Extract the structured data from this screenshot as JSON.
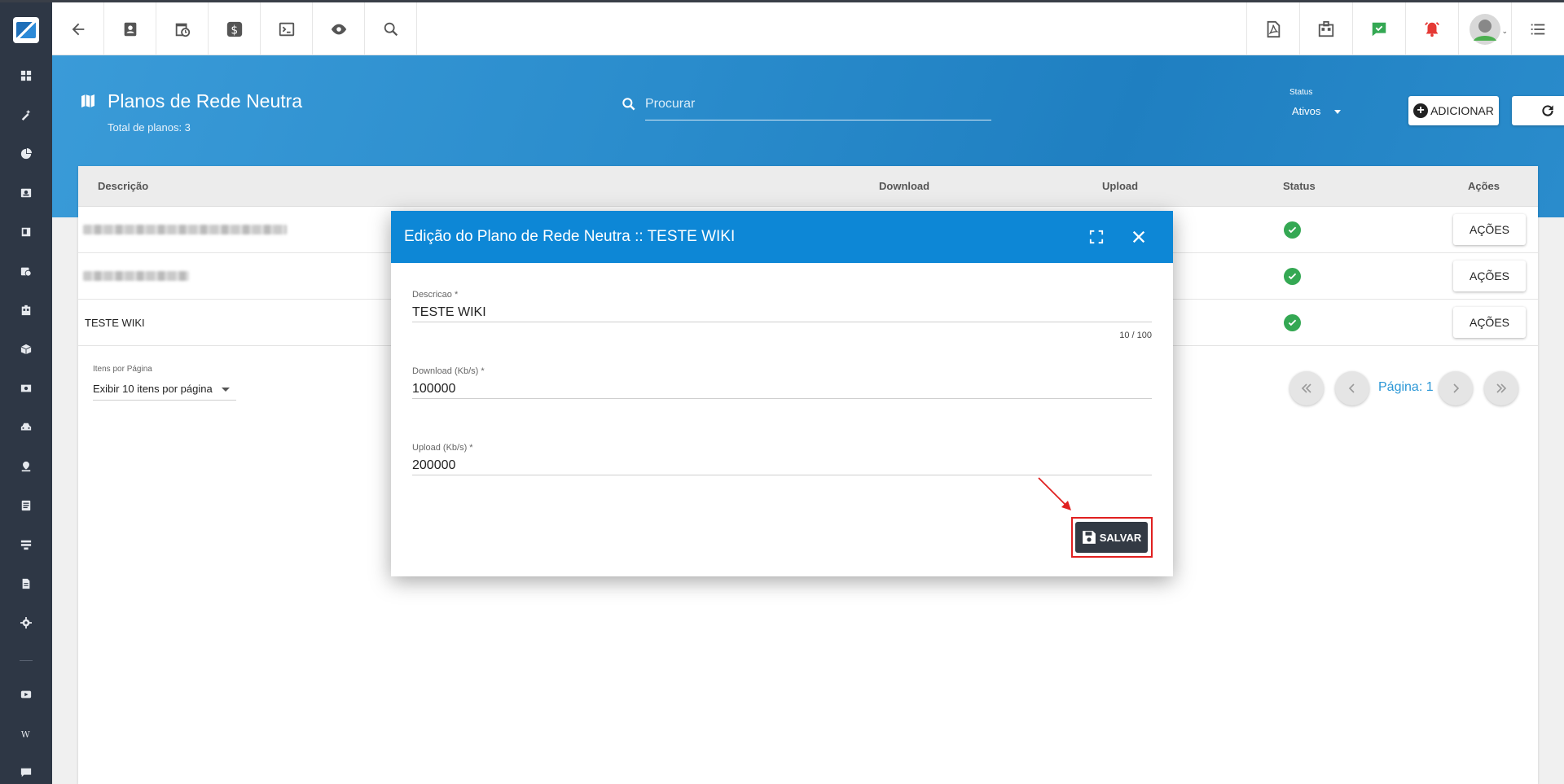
{
  "topbar": {
    "left_icons": [
      "back-arrow-icon",
      "contact-card-icon",
      "calendar-clock-icon",
      "dollar-icon",
      "terminal-icon",
      "eye-icon",
      "search-icon"
    ],
    "right_icons": [
      "pdf-icon",
      "calendar-building-icon",
      "chat-check-icon",
      "alarm-bell-icon",
      "avatar",
      "list-menu-icon"
    ],
    "colors": {
      "chat": "#34a853",
      "alarm": "#e53935"
    }
  },
  "sidebar": {
    "icons": [
      "dashboard-icon",
      "wand-icon",
      "pie-chart-icon",
      "contact-icon",
      "book-icon",
      "calendar-clock-icon",
      "building-icon",
      "package-icon",
      "money-icon",
      "car-icon",
      "location-icon",
      "clipboard-icon",
      "server-icon",
      "document-icon",
      "gear-icon",
      "video-icon",
      "wiki-icon",
      "chat-icon"
    ]
  },
  "header": {
    "title": "Planos de Rede Neutra",
    "subtitle": "Total de planos: 3",
    "search_placeholder": "Procurar",
    "status_label": "Status",
    "status_value": "Ativos",
    "add_label": "ADICIONAR"
  },
  "table": {
    "columns": {
      "descricao": "Descrição",
      "download": "Download",
      "upload": "Upload",
      "status": "Status",
      "acoes": "Ações"
    },
    "rows": [
      {
        "descricao": "",
        "status": "active",
        "action": "AÇÕES"
      },
      {
        "descricao": "",
        "status": "active",
        "action": "AÇÕES"
      },
      {
        "descricao": "TESTE WIKI",
        "status": "active",
        "action": "AÇÕES"
      }
    ],
    "status_color": "#34a853"
  },
  "pagination": {
    "items_label": "Itens por Página",
    "items_value": "Exibir 10 itens por página",
    "page_label": "Página: 1"
  },
  "modal": {
    "title": "Edição do Plano de Rede Neutra :: TESTE WIKI",
    "fields": {
      "descricao": {
        "label": "Descricao *",
        "value": "TESTE WIKI",
        "counter": "10 / 100"
      },
      "download": {
        "label": "Download (Kb/s) *",
        "value": "100000"
      },
      "upload": {
        "label": "Upload (Kb/s) *",
        "value": "200000"
      }
    },
    "save_label": "SALVAR",
    "header_color": "#0d87d6"
  }
}
